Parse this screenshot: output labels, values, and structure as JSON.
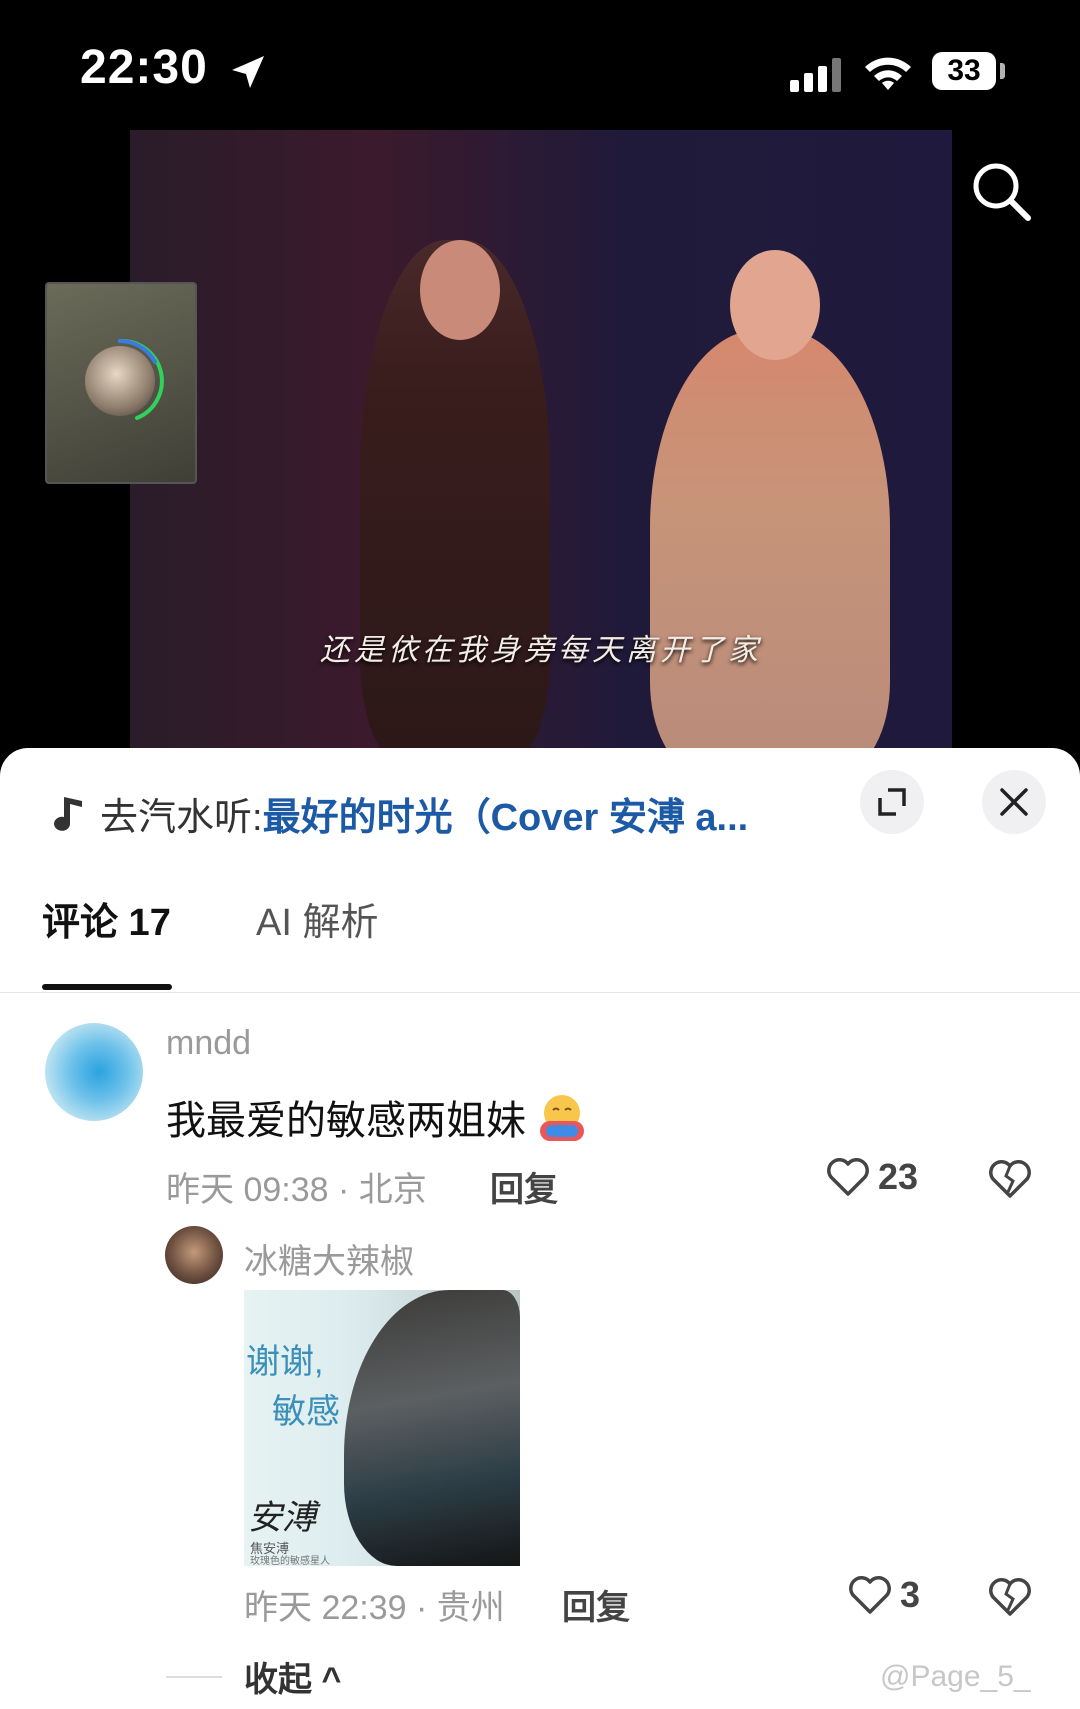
{
  "status_bar": {
    "time": "22:30",
    "battery": "33"
  },
  "video": {
    "subtitle": "还是依在我身旁每天离开了家"
  },
  "music_bar": {
    "prefix": "去汽水听:",
    "title": "最好的时光（Cover 安溥 a..."
  },
  "tabs": {
    "comments": "评论 17",
    "ai": "AI 解析"
  },
  "comment": {
    "user": "mndd",
    "text": "我最爱的敏感两姐妹",
    "meta": "昨天 09:38 · 北京",
    "reply_label": "回复",
    "likes": "23"
  },
  "reply_comment": {
    "user": "冰糖大辣椒",
    "sticker": {
      "line1": "谢谢,",
      "line2": "敏感",
      "signature": "安溥",
      "small1": "焦安溥",
      "small2": "玫瑰色的敏感星人"
    },
    "meta": "昨天 22:39 · 贵州",
    "reply_label": "回复",
    "likes": "3"
  },
  "collapse_label": "收起 ^",
  "watermark": "@Page_5_",
  "colors": {
    "link": "#1d5aa5",
    "meta_gray": "#9a9a9a"
  }
}
